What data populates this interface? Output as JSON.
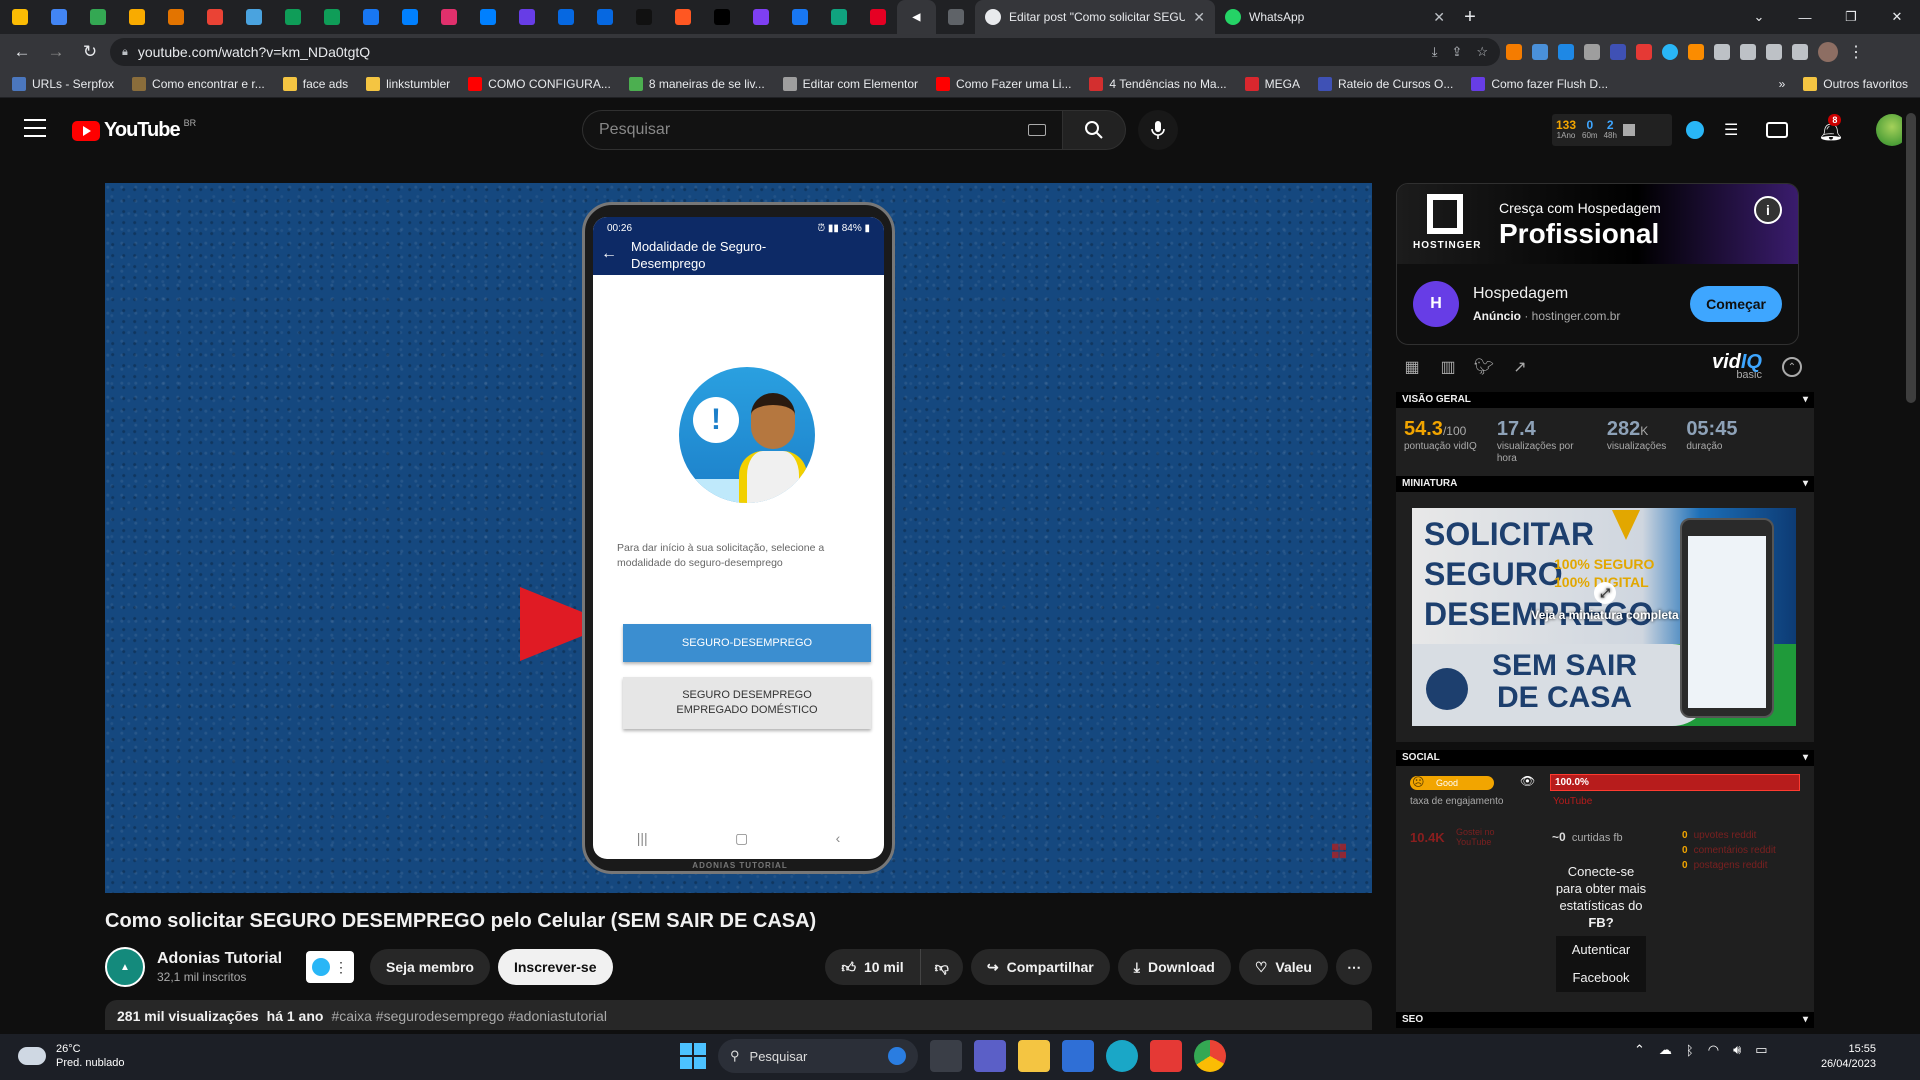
{
  "browser": {
    "pinned_tabs": [
      {
        "icon": "google-ads-icon",
        "color": "#fbbc04"
      },
      {
        "icon": "google-ads-icon",
        "color": "#4285f4"
      },
      {
        "icon": "google-ads-icon",
        "color": "#34a853"
      },
      {
        "icon": "analytics-icon",
        "color": "#f9ab00"
      },
      {
        "icon": "analytics-icon",
        "color": "#e37400"
      },
      {
        "icon": "gmail-icon",
        "color": "#ea4335"
      },
      {
        "icon": "bot-icon",
        "color": "#4aa3df"
      },
      {
        "icon": "sheets-icon",
        "color": "#0f9d58"
      },
      {
        "icon": "sheets-icon",
        "color": "#0f9d58"
      },
      {
        "icon": "meta-icon",
        "color": "#1877f2"
      },
      {
        "icon": "digitalocean-icon",
        "color": "#0080ff"
      },
      {
        "icon": "instagram-icon",
        "color": "#e1306c"
      },
      {
        "icon": "digitalocean-icon",
        "color": "#0080ff"
      },
      {
        "icon": "hostinger-icon",
        "color": "#673de6"
      },
      {
        "icon": "meta-icon",
        "color": "#0668e1"
      },
      {
        "icon": "meta-icon",
        "color": "#0668e1"
      },
      {
        "icon": "a-icon",
        "color": "#111111"
      },
      {
        "icon": "fire-icon",
        "color": "#ff5722"
      },
      {
        "icon": "tiktok-icon",
        "color": "#000000"
      },
      {
        "icon": "stats-icon",
        "color": "#7e3ff2"
      },
      {
        "icon": "facebook-icon",
        "color": "#1877f2"
      },
      {
        "icon": "chatgpt-icon",
        "color": "#10a37f"
      },
      {
        "icon": "pinterest-icon",
        "color": "#e60023"
      },
      {
        "icon": "speaker-icon",
        "color": "#35363a"
      },
      {
        "icon": "globe-icon",
        "color": "#5f6368"
      }
    ],
    "tabs": [
      {
        "title": "Editar post \"Como solicitar SEGU",
        "icon": "wordpress-icon",
        "active": true
      },
      {
        "title": "WhatsApp",
        "icon": "whatsapp-icon",
        "active": false
      }
    ],
    "url": "youtube.com/watch?v=km_NDa0tgtQ",
    "bookmarks": [
      {
        "label": "URLs - Serpfox",
        "color": "#4b77be"
      },
      {
        "label": "Como encontrar e r...",
        "color": "#8a6d3b"
      },
      {
        "label": "face ads",
        "color": "#f4c542"
      },
      {
        "label": "linkstumbler",
        "color": "#f4c542"
      },
      {
        "label": "COMO CONFIGURA...",
        "color": "#ff0000"
      },
      {
        "label": "8 maneiras de se liv...",
        "color": "#4caf50"
      },
      {
        "label": "Editar com Elementor",
        "color": "#9e9e9e"
      },
      {
        "label": "Como Fazer uma Li...",
        "color": "#ff0000"
      },
      {
        "label": "4 Tendências no Ma...",
        "color": "#d32f2f"
      },
      {
        "label": "MEGA",
        "color": "#d9272e"
      },
      {
        "label": "Rateio de Cursos O...",
        "color": "#3f51b5"
      },
      {
        "label": "Como fazer Flush D...",
        "color": "#673de6"
      }
    ],
    "bookmarks_more": "»",
    "other_bookmarks": "Outros favoritos"
  },
  "youtube": {
    "logo": "YouTube",
    "country": "BR",
    "search_placeholder": "Pesquisar",
    "vidiq_header": [
      {
        "value": "133",
        "label": "1Ano"
      },
      {
        "value": "0",
        "label": "60m"
      },
      {
        "value": "2",
        "label": "48h"
      }
    ],
    "notifications": "8"
  },
  "video": {
    "phone": {
      "time": "00:26",
      "battery": "84%",
      "screen_title": "Modalidade de Seguro-Desemprego",
      "description": "Para dar início à sua solicitação, selecione a modalidade do seguro-desemprego",
      "button_primary": "SEGURO-DESEMPREGO",
      "button_secondary_l1": "SEGURO DESEMPREGO",
      "button_secondary_l2": "EMPREGADO DOMÉSTICO",
      "brand": "ADONIAS TUTORIAL"
    },
    "title": "Como solicitar SEGURO DESEMPREGO pelo Celular (SEM SAIR DE CASA)",
    "channel_name": "Adonias Tutorial",
    "subscribers": "32,1 mil inscritos",
    "join_label": "Seja membro",
    "subscribe_label": "Inscrever-se",
    "likes": "10 mil",
    "share_label": "Compartilhar",
    "download_label": "Download",
    "thanks_label": "Valeu",
    "views": "281 mil visualizações",
    "age": "há 1 ano",
    "tags": "#caixa #segurodesemprego #adoniastutorial"
  },
  "ad": {
    "banner_line1": "Cresça com Hospedagem",
    "banner_line2": "Profissional",
    "brand_logo": "HOSTINGER",
    "name": "Hospedagem",
    "tag": "Anúncio",
    "domain": "hostinger.com.br",
    "cta": "Começar"
  },
  "vidiq": {
    "logo": "vidIQ",
    "plan": "basic",
    "overview_title": "VISÃO GERAL",
    "score": "54.3",
    "score_max": "/100",
    "score_label": "pontuação vidIQ",
    "vph": "17.4",
    "vph_label": "visualizações por hora",
    "views": "282",
    "views_unit": "K",
    "views_label": "visualizações",
    "duration": "05:45",
    "duration_label": "duração",
    "thumbnail_title": "MINIATURA",
    "thumbnail_overlay": "Veja a miniatura completa",
    "thumb_text_1": "SOLICITAR",
    "thumb_text_2": "SEGURO",
    "thumb_text_3": "DESEMPREGO",
    "thumb_badge_1": "100% SEGURO",
    "thumb_badge_2": "100% DIGITAL",
    "thumb_text_4": "SEM SAIR",
    "thumb_text_5": "DE CASA",
    "social_title": "SOCIAL",
    "engagement_value": "Good",
    "engagement_label": "taxa de engajamento",
    "yt_share": "100.0%",
    "yt_share_label": "YouTube",
    "likes": "10.4K",
    "likes_label": "Gostei no YouTube",
    "fb_shares": "~0",
    "fb_shares_label": "curtidas fb",
    "reddit_upvotes": "0",
    "reddit_upvotes_label": "upvotes reddit",
    "reddit_comments": "0",
    "reddit_comments_label": "comentários reddit",
    "reddit_posts": "0",
    "reddit_posts_label": "postagens reddit",
    "fb_connect_l1": "Conecte-se",
    "fb_connect_l2": "para obter mais",
    "fb_connect_l3": "estatísticas do",
    "fb_connect_l4": "FB?",
    "fb_auth_l1": "Autenticar",
    "fb_auth_l2": "Facebook",
    "seo_title": "SEO"
  },
  "taskbar": {
    "temperature": "26°C",
    "weather": "Pred. nublado",
    "search_label": "Pesquisar",
    "time": "15:55",
    "date": "26/04/2023"
  }
}
